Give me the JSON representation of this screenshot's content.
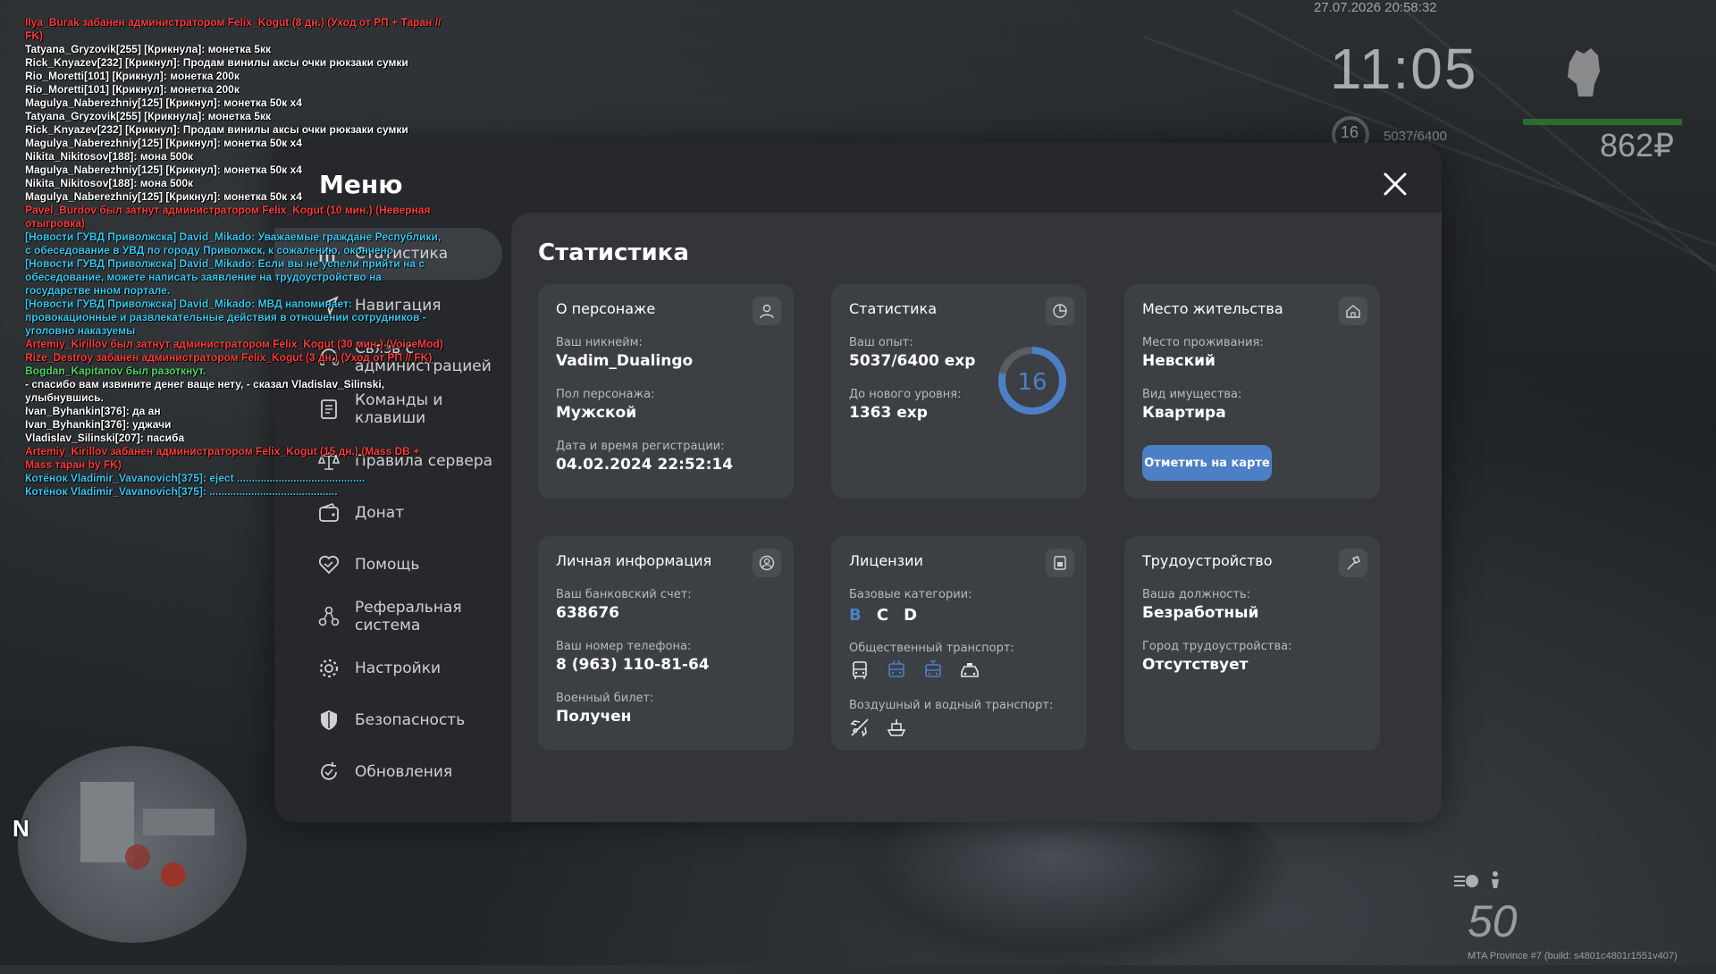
{
  "chat": [
    {
      "text": "Ilya_Burak забанен администратором Felix_Kogut (8 дн.) (Уход от РП + Таран // FK)",
      "color": "#ff3b3b"
    },
    {
      "text": "Tatyana_Gryzovik[255] [Крикнула]: монетка 5кк",
      "color": "#ffffff"
    },
    {
      "text": "Rick_Knyazev[232] [Крикнул]: Продам винилы аксы очки рюкзаки сумки",
      "color": "#ffffff"
    },
    {
      "text": "Rio_Moretti[101] [Крикнул]: монетка 200к",
      "color": "#ffffff"
    },
    {
      "text": "Rio_Moretti[101] [Крикнул]: монетка 200к",
      "color": "#ffffff"
    },
    {
      "text": "Magulya_Naberezhniy[125] [Крикнул]: монетка 50к x4",
      "color": "#ffffff"
    },
    {
      "text": "Tatyana_Gryzovik[255] [Крикнула]: монетка 5кк",
      "color": "#ffffff"
    },
    {
      "text": "Rick_Knyazev[232] [Крикнул]: Продам винилы аксы очки рюкзаки сумки",
      "color": "#ffffff"
    },
    {
      "text": "Magulya_Naberezhniy[125] [Крикнул]: монетка 50к x4",
      "color": "#ffffff"
    },
    {
      "text": "Nikita_Nikitosov[188]: мона 500к",
      "color": "#ffffff"
    },
    {
      "text": "Magulya_Naberezhniy[125] [Крикнул]: монетка 50к x4",
      "color": "#ffffff"
    },
    {
      "text": "Nikita_Nikitosov[188]: мона 500к",
      "color": "#ffffff"
    },
    {
      "text": "Magulya_Naberezhniy[125] [Крикнул]: монетка 50к x4",
      "color": "#ffffff"
    },
    {
      "text": "Pavel_Burdov был затнут администратором Felix_Kogut (10 мин.) (Неверная отыгровка)",
      "color": "#ff3b3b"
    },
    {
      "text": "[Новости ГУВД Приволжска] David_Mikado: Уважаемые граждане Республики, с обеседование в УВД по городу Приволжск, к сожалению, окончено",
      "color": "#35c8f0"
    },
    {
      "text": "[Новости ГУВД Приволжска] David_Mikado: Если вы не успели прийти на с обеседование, можете написать заявление на трудоустройство на государстве нном портале.",
      "color": "#35c8f0"
    },
    {
      "text": "[Новости ГУВД Приволжска] David_Mikado: МВД напоминает: провокационные и развлекательные действия в отношении сотрудников - уголовно наказуемы",
      "color": "#35c8f0"
    },
    {
      "text": "Artemiy_Kirillov был затнут администратором Felix_Kogut (30 мин.) (VoiceMod)",
      "color": "#ff3b3b"
    },
    {
      "text": "Rize_Destroy забанен администратором Felix_Kogut (3 дн.) (Уход от РП // FK)",
      "color": "#ff3b3b"
    },
    {
      "text": "Bogdan_Kapitanov был разоткнут.",
      "color": "#4cd964"
    },
    {
      "text": "- спасибо вам извините денег ваще нету, - сказал Vladislav_Silinski, улыбнувшись.",
      "color": "#ffffff"
    },
    {
      "text": "Ivan_Byhankin[376]: да ан",
      "color": "#ffffff"
    },
    {
      "text": "Ivan_Byhankin[376]: уджачи",
      "color": "#ffffff"
    },
    {
      "text": "Vladislav_Silinski[207]: пасиба",
      "color": "#ffffff"
    },
    {
      "text": "Artemiy_Kirillov забанен администратором Felix_Kogut (15 дн.) (Mass DB + Mass таран by FK)",
      "color": "#ff3b3b"
    },
    {
      "text": "Котёнок Vladimir_Vavanovich[375]: eject ...........................................",
      "color": "#35c8f0"
    },
    {
      "text": "Котёнок Vladimir_Vavanovich[375]: ...........................................",
      "color": "#35c8f0"
    }
  ],
  "hud": {
    "date": "27.07.2026 20:58:32",
    "time": "11:05",
    "level": "16",
    "exp": "5037/6400",
    "money": "862₽",
    "speed": "50",
    "build": "MTA Province #7 (build: s4801c4801r1551v407)",
    "minimap_north": "N",
    "health_color": "#2e7d32"
  },
  "menu": {
    "title": "Меню",
    "sidebar": [
      {
        "label": "Статистика",
        "icon": "chart-icon",
        "active": true
      },
      {
        "label": "Навигация",
        "icon": "navigation-icon"
      },
      {
        "label": "Связь с администрацией",
        "icon": "headset-icon"
      },
      {
        "label": "Команды и клавиши",
        "icon": "document-icon"
      },
      {
        "label": "Правила сервера",
        "icon": "scales-icon"
      },
      {
        "label": "Донат",
        "icon": "wallet-icon"
      },
      {
        "label": "Помощь",
        "icon": "handshake-icon"
      },
      {
        "label": "Реферальная система",
        "icon": "referral-icon"
      },
      {
        "label": "Настройки",
        "icon": "gear-icon"
      },
      {
        "label": "Безопасность",
        "icon": "shield-icon"
      },
      {
        "label": "Обновления",
        "icon": "update-icon"
      }
    ]
  },
  "content": {
    "title": "Статистика",
    "character": {
      "title": "О персонаже",
      "nick_label": "Ваш никнейм:",
      "nick": "Vadim_Dualingo",
      "gender_label": "Пол персонажа:",
      "gender": "Мужской",
      "reg_label": "Дата и время регистрации:",
      "reg": "04.02.2024 22:52:14"
    },
    "stats": {
      "title": "Статистика",
      "exp_label": "Ваш опыт:",
      "exp": "5037/6400 exp",
      "next_label": "До нового уровня:",
      "next": "1363 exp",
      "level": "16",
      "progress": 0.787
    },
    "residence": {
      "title": "Место жительства",
      "place_label": "Место проживания:",
      "place": "Невский",
      "type_label": "Вид имущества:",
      "type": "Квартира",
      "button": "Отметить на карте"
    },
    "personal": {
      "title": "Личная информация",
      "bank_label": "Ваш банковский счет:",
      "bank": "638676",
      "phone_label": "Ваш номер телефона:",
      "phone": "8 (963) 110-81-64",
      "military_label": "Военный билет:",
      "military": "Получен"
    },
    "licenses": {
      "title": "Лицензии",
      "base_label": "Базовые категории:",
      "categories": [
        "B",
        "C",
        "D"
      ],
      "public_label": "Общественный транспорт:",
      "public_icons": [
        "bus-icon",
        "trolleybus-icon",
        "tram-icon",
        "taxi-icon"
      ],
      "air_label": "Воздушный и водный транспорт:",
      "air_icons": [
        "plane-icon",
        "boat-icon"
      ],
      "accent": "#4d7fc7"
    },
    "employment": {
      "title": "Трудоустройство",
      "job_label": "Ваша должность:",
      "job": "Безработный",
      "city_label": "Город трудоустройства:",
      "city": "Отсутствует"
    }
  }
}
